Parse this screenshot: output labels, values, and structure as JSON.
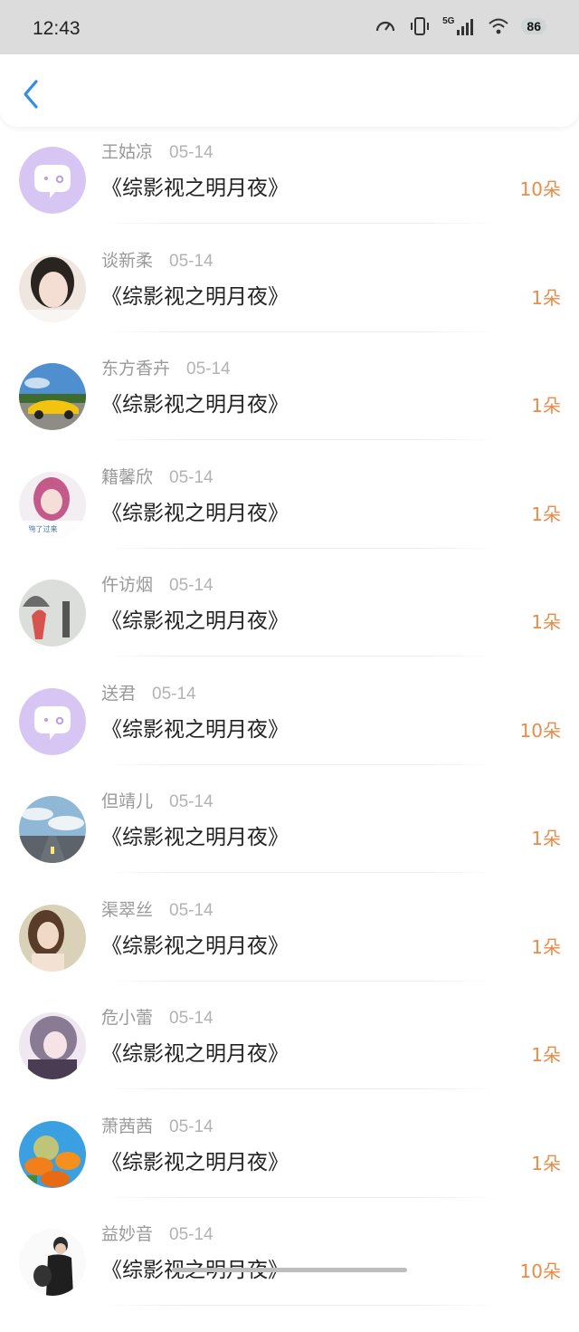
{
  "status_bar": {
    "time": "12:43",
    "network": "5G",
    "battery": "86",
    "icons": [
      "speedometer-icon",
      "vibrate-icon",
      "signal-icon",
      "wifi-icon",
      "battery-icon"
    ]
  },
  "nav": {
    "back_icon": "chevron-left-icon",
    "accent_color": "#2f8ee8"
  },
  "list": {
    "amount_color": "#ec8a46",
    "items": [
      {
        "name": "王姑凉",
        "date": "05-14",
        "title": "《综影视之明月夜》",
        "amount": "10朵",
        "avatar": "default-chat-avatar"
      },
      {
        "name": "谈新柔",
        "date": "05-14",
        "title": "《综影视之明月夜》",
        "amount": "1朵",
        "avatar": "girl-portrait"
      },
      {
        "name": "东方香卉",
        "date": "05-14",
        "title": "《综影视之明月夜》",
        "amount": "1朵",
        "avatar": "yellow-car"
      },
      {
        "name": "籍馨欣",
        "date": "05-14",
        "title": "《综影视之明月夜》",
        "amount": "1朵",
        "avatar": "pink-hair-girl"
      },
      {
        "name": "仵访烟",
        "date": "05-14",
        "title": "《综影视之明月夜》",
        "amount": "1朵",
        "avatar": "umbrella-rain"
      },
      {
        "name": "送君",
        "date": "05-14",
        "title": "《综影视之明月夜》",
        "amount": "10朵",
        "avatar": "default-chat-avatar"
      },
      {
        "name": "但靖儿",
        "date": "05-14",
        "title": "《综影视之明月夜》",
        "amount": "1朵",
        "avatar": "road-sky"
      },
      {
        "name": "渠翠丝",
        "date": "05-14",
        "title": "《综影视之明月夜》",
        "amount": "1朵",
        "avatar": "woman-portrait"
      },
      {
        "name": "危小蕾",
        "date": "05-14",
        "title": "《综影视之明月夜》",
        "amount": "1朵",
        "avatar": "anime-girl"
      },
      {
        "name": "萧茜茜",
        "date": "05-14",
        "title": "《综影视之明月夜》",
        "amount": "1朵",
        "avatar": "orange-flowers"
      },
      {
        "name": "益妙音",
        "date": "05-14",
        "title": "《综影视之明月夜》",
        "amount": "10朵",
        "avatar": "man-with-bag"
      }
    ]
  }
}
